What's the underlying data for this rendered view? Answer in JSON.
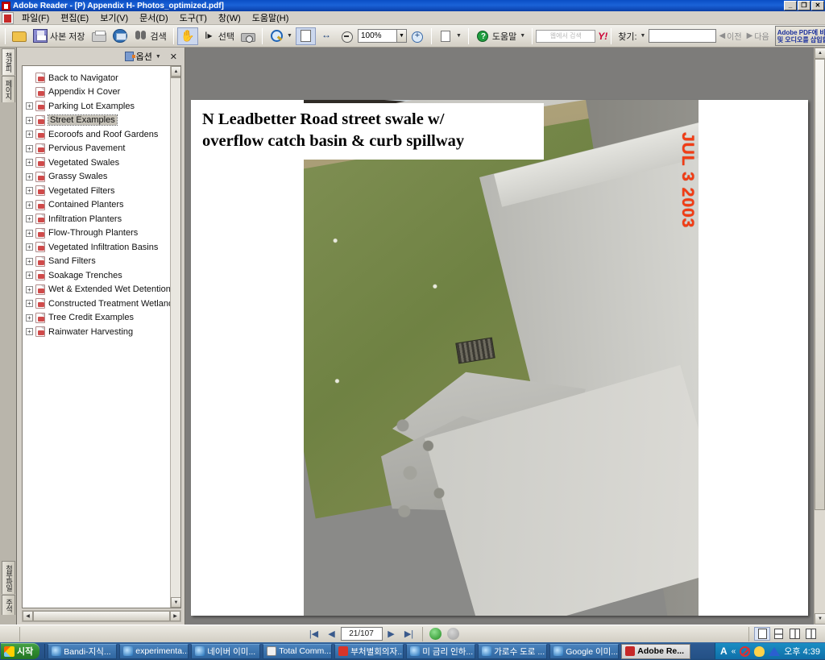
{
  "window": {
    "title": "Adobe Reader - [P) Appendix H- Photos_optimized.pdf]",
    "minimize": "_",
    "restore": "❐",
    "close": "✕"
  },
  "menubar": {
    "items": [
      {
        "label": "파일(F)"
      },
      {
        "label": "편집(E)"
      },
      {
        "label": "보기(V)"
      },
      {
        "label": "문서(D)"
      },
      {
        "label": "도구(T)"
      },
      {
        "label": "창(W)"
      },
      {
        "label": "도움말(H)"
      }
    ]
  },
  "toolbar": {
    "open_icon": "folder-open-icon",
    "save_copy_label": "사본 저장",
    "print_icon": "print-icon",
    "email_icon": "email-icon",
    "search_label": "검색",
    "hand_icon": "hand-tool-icon",
    "select_label": "선택",
    "snapshot_icon": "camera-snapshot-icon",
    "zoom_icon": "zoom-in-icon",
    "fit_page_icon": "fit-page-icon",
    "fit_width_icon": "fit-width-icon",
    "zoom_out_icon": "zoom-out-icon",
    "zoom_value": "100%",
    "zoom_in_icon": "zoom-in-circle-icon",
    "rotate_icon": "page-rotate-icon",
    "help_label": "도움말",
    "yahoo_search_placeholder": "웹에서 검색",
    "yahoo_logo": "Y!",
    "find_label": "찾기:",
    "find_value": "",
    "previous_label": "이전",
    "next_label": "다음",
    "ad_banner_line1": "Adobe PDF에 비디오",
    "ad_banner_line2": "및 오디오를 삽입할 수"
  },
  "sidebar": {
    "vertical_tabs_top": [
      {
        "label": "책갈피",
        "active": true
      },
      {
        "label": "페이지",
        "active": false
      }
    ],
    "vertical_tabs_bottom": [
      {
        "label": "첨부파일"
      },
      {
        "label": "주석"
      }
    ],
    "panel": {
      "options_label": "옵션",
      "close_label": "✕"
    },
    "bookmarks": [
      {
        "label": "Back to Navigator",
        "expandable": false,
        "selected": false
      },
      {
        "label": "Appendix H Cover",
        "expandable": false,
        "selected": false
      },
      {
        "label": "Parking Lot Examples",
        "expandable": true,
        "selected": false
      },
      {
        "label": "Street Examples",
        "expandable": true,
        "selected": true
      },
      {
        "label": "Ecoroofs and Roof Gardens",
        "expandable": true,
        "selected": false
      },
      {
        "label": "Pervious Pavement",
        "expandable": true,
        "selected": false
      },
      {
        "label": "Vegetated Swales",
        "expandable": true,
        "selected": false
      },
      {
        "label": "Grassy Swales",
        "expandable": true,
        "selected": false
      },
      {
        "label": "Vegetated Filters",
        "expandable": true,
        "selected": false
      },
      {
        "label": "Contained Planters",
        "expandable": true,
        "selected": false
      },
      {
        "label": "Infiltration Planters",
        "expandable": true,
        "selected": false
      },
      {
        "label": "Flow-Through Planters",
        "expandable": true,
        "selected": false
      },
      {
        "label": "Vegetated Infiltration Basins",
        "expandable": true,
        "selected": false
      },
      {
        "label": "Sand Filters",
        "expandable": true,
        "selected": false
      },
      {
        "label": "Soakage Trenches",
        "expandable": true,
        "selected": false
      },
      {
        "label": "Wet & Extended Wet Detention Por",
        "expandable": true,
        "selected": false
      },
      {
        "label": "Constructed Treatment Wetlands",
        "expandable": true,
        "selected": false
      },
      {
        "label": "Tree Credit Examples",
        "expandable": true,
        "selected": false
      },
      {
        "label": "Rainwater Harvesting",
        "expandable": true,
        "selected": false
      }
    ]
  },
  "document": {
    "slide_title_line1": "N Leadbetter Road street swale w/",
    "slide_title_line2": "overflow catch basin & curb spillway",
    "photo_datestamp": "JUL 3 2003",
    "photo_alt": "street-swale-photo"
  },
  "statusbar": {
    "first_page_icon": "first-page-icon",
    "prev_page_icon": "previous-page-icon",
    "page_value": "21/107",
    "next_page_icon": "next-page-icon",
    "last_page_icon": "last-page-icon",
    "back_icon": "previous-view-icon",
    "forward_icon": "next-view-icon",
    "view_single_icon": "single-page-view-icon",
    "view_continuous_icon": "continuous-view-icon",
    "view_facing_icon": "facing-pages-view-icon",
    "view_continuous_facing_icon": "continuous-facing-view-icon"
  },
  "taskbar": {
    "start_label": "시작",
    "items": [
      {
        "label": "Bandi-지식...",
        "icon": "ie-icon",
        "active": false
      },
      {
        "label": "experimenta...",
        "icon": "ie-icon",
        "active": false
      },
      {
        "label": "네이버 이미...",
        "icon": "ie-icon",
        "active": false
      },
      {
        "label": "Total Comm...",
        "icon": "total-commander-icon",
        "active": false
      },
      {
        "label": "부처별회의자...",
        "icon": "hwp-icon",
        "active": false
      },
      {
        "label": "미 금리 인하...",
        "icon": "ie-icon",
        "active": false
      },
      {
        "label": "가로수 도로 ...",
        "icon": "ie-icon",
        "active": false
      },
      {
        "label": "Google 이미...",
        "icon": "ie-icon",
        "active": false
      },
      {
        "label": "Adobe Re...",
        "icon": "acrobat-icon",
        "active": true
      }
    ],
    "tray": {
      "ime_label": "A",
      "chevron": "«",
      "icons": [
        "block-icon",
        "person-icon",
        "triangle-icon"
      ],
      "clock": "오후 4:39"
    }
  },
  "colors": {
    "titlebar_blue": "#0b4fc4",
    "taskbar_blue": "#2d5a92",
    "start_green": "#2f8a2f",
    "accent_selection": "#c6c2b8",
    "datestamp_red": "#f23c14",
    "yahoo_red": "#cc0033"
  }
}
